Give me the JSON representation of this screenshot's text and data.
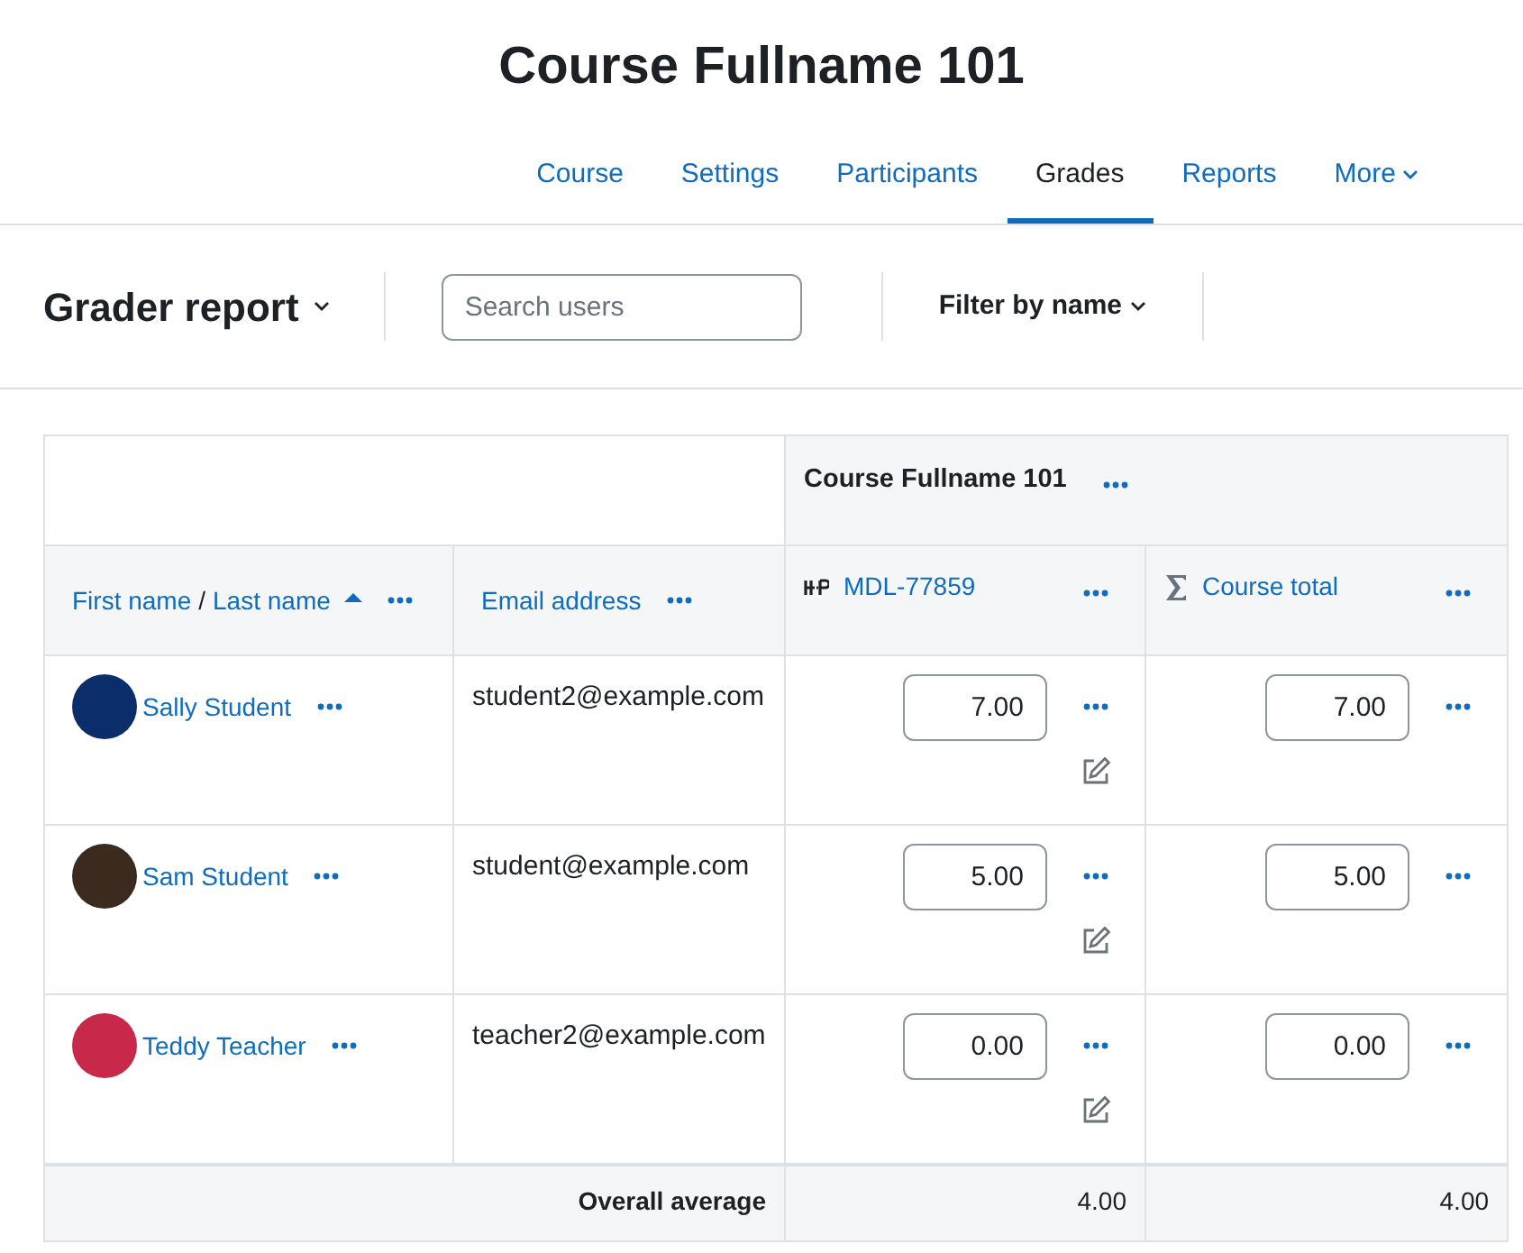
{
  "page_title": "Course Fullname 101",
  "nav": [
    {
      "label": "Course",
      "selected": false
    },
    {
      "label": "Settings",
      "selected": false
    },
    {
      "label": "Participants",
      "selected": false
    },
    {
      "label": "Grades",
      "selected": true
    },
    {
      "label": "Reports",
      "selected": false
    },
    {
      "label": "More",
      "selected": false,
      "kind": "dropdown"
    }
  ],
  "toolbar": {
    "report_selector": "Grader report",
    "search": {
      "placeholder": "Search users"
    },
    "filter": "Filter by name"
  },
  "table": {
    "category": "Course Fullname 101",
    "columns": [
      {
        "kind": "name",
        "first": "First name",
        "separator": "/",
        "last": "Last name"
      },
      {
        "kind": "email",
        "label": "Email address"
      },
      {
        "kind": "grade_item",
        "label": "MDL-77859"
      },
      {
        "kind": "total",
        "label": "Course total"
      }
    ],
    "rows": [
      {
        "name": "Sally Student",
        "color": "#0b2e6b",
        "email": "student2@example.com",
        "grade": "7.00",
        "total": "7.00"
      },
      {
        "name": "Sam Student",
        "color": "#3b2a1e",
        "email": "student@example.com",
        "grade": "5.00",
        "total": "5.00"
      },
      {
        "name": "Teddy Teacher",
        "color": "#c8284a",
        "email": "teacher2@example.com",
        "grade": "0.00",
        "total": "0.00"
      }
    ],
    "footer": {
      "label": "Overall average",
      "grade": "4.00",
      "total": "4.00"
    }
  }
}
